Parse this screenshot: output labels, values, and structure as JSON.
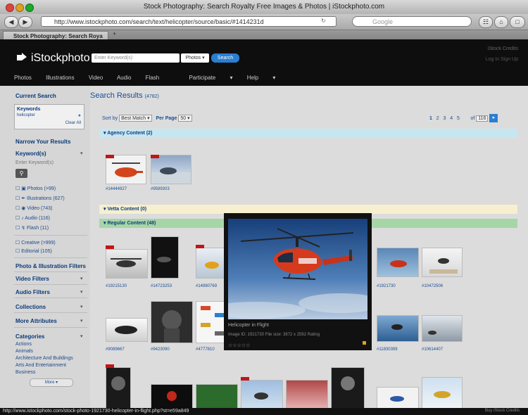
{
  "window": {
    "title": "Stock Photography: Search Royalty Free Images & Photos | iStockphoto.com",
    "url": "http://www.istockphoto.com/search/text/helicopter/source/basic/#1414231d",
    "search_engine": "Google",
    "tab_title": "Stock Photography: Search Roya"
  },
  "site": {
    "logo": "iStockphoto",
    "keyword_placeholder": "Enter Keyword(s)",
    "filetype": "Photos",
    "search_button": "Search",
    "account_1": "iStock Credits",
    "account_2": "Log In    Sign Up",
    "nav": [
      "Photos",
      "Illustrations",
      "Video",
      "Audio",
      "Flash",
      "Participate",
      "Help"
    ]
  },
  "sidebar": {
    "current_search": "Current Search",
    "keywords_label": "Keywords",
    "keyword_value": "helicopter",
    "clear_all": "Clear All",
    "narrow": "Narrow Your Results",
    "keyword_section": "Keyword(s)",
    "enter_keywords": "Enter Keyword(s)",
    "types": [
      {
        "label": "Photos",
        "count": "(>99)"
      },
      {
        "label": "Illustrations",
        "count": "(627)"
      },
      {
        "label": "Video",
        "count": "(743)"
      },
      {
        "label": "Audio",
        "count": "(116)"
      },
      {
        "label": "Flash",
        "count": "(11)"
      }
    ],
    "creative": "Creative (>999)",
    "editorial": "Editorial (105)",
    "filters": [
      "Photo & Illustration Filters",
      "Video Filters",
      "Audio Filters",
      "Collections",
      "More Attributes",
      "Categories"
    ],
    "categories": [
      "Actions",
      "Animals",
      "Architecture And Buildings",
      "Arts And Entertainment",
      "Business"
    ],
    "more": "More"
  },
  "main": {
    "title": "Search Results",
    "count": "(4782)",
    "sort_label": "Sort by",
    "sort_value": "Best Match",
    "perpage_label": "Per Page",
    "perpage_value": "50",
    "pages": [
      "1",
      "2",
      "3",
      "4",
      "5"
    ],
    "of_label": "of",
    "total_pages": "116",
    "bands": {
      "agency": "Agency Content (2)",
      "vetta": "Vetta Content (0)",
      "regular": "Regular Content (48)"
    },
    "agency_captions": [
      "#14444927",
      "#9589303"
    ],
    "row1_captions": [
      "#19215130",
      "#14723253",
      "#14980769",
      "",
      "",
      "",
      "",
      "#1921730",
      "#10472506"
    ],
    "row2_captions": [
      "#9089667",
      "#9423090",
      "#4777810",
      "#13534058",
      "#13339825",
      "#13339850",
      "#11830399",
      "#10614407"
    ]
  },
  "preview": {
    "title": "Helicopter in Flight",
    "desc": "Image ID: 1921730   File size: 3872 x 2592   Rating"
  },
  "status": {
    "url": "http://www.istockphoto.com/stock-photo-1921730-helicopter-in-flight.php?st=e59a849",
    "right": "Buy iStock Credits"
  },
  "colors": {
    "accent": "#2a7fd0",
    "agency_band": "#c6e6f2",
    "vetta_band": "#f6f0cf",
    "regular_band": "#a6d6a6",
    "exclusive_tag": "#c21515"
  }
}
